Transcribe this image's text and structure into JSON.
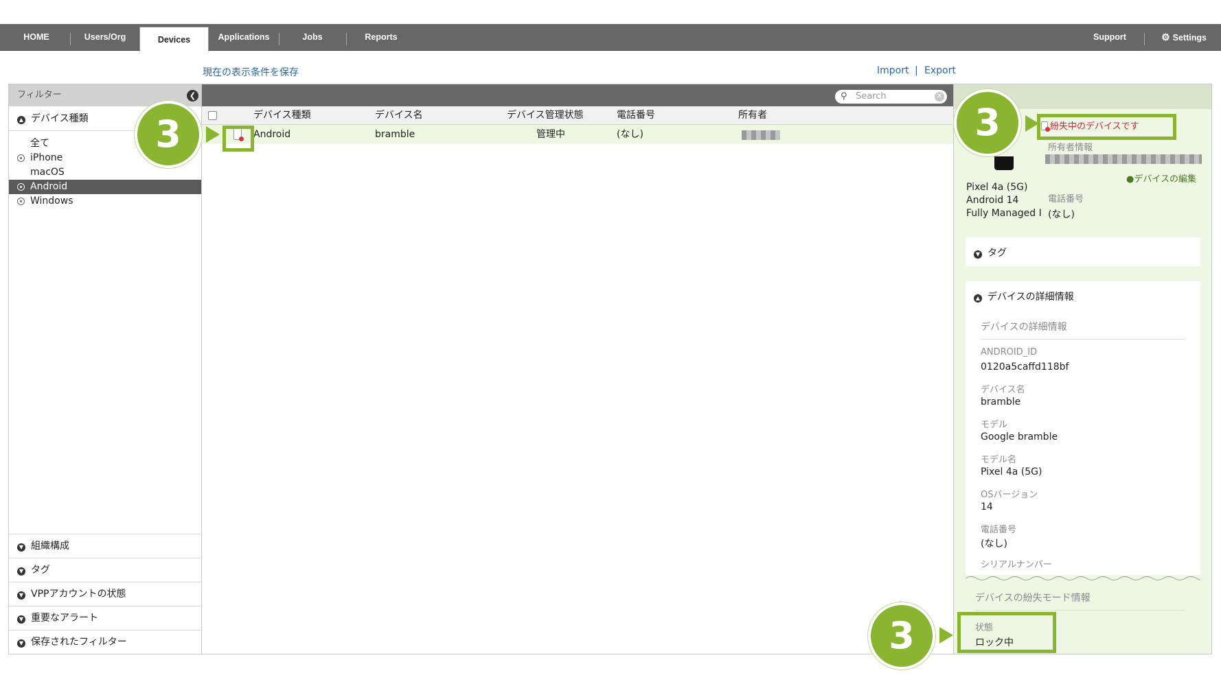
{
  "nav": {
    "items": [
      "HOME",
      "Users/Org",
      "Devices",
      "Applications",
      "Jobs",
      "Reports"
    ],
    "active": "Devices",
    "support": "Support",
    "settings": "Settings"
  },
  "toolbar_links": {
    "save_filter": "現在の表示条件を保存",
    "import": "Import",
    "separator": "|",
    "export": "Export"
  },
  "filter": {
    "title": "フィルター",
    "device_type_title": "デバイス種類",
    "device_types": [
      "全て",
      "iPhone",
      "macOS",
      "Android",
      "Windows"
    ],
    "selected_device_type": "Android",
    "bottom_sections": [
      "組織構成",
      "タグ",
      "VPPアカウントの状態",
      "重要なアラート",
      "保存されたフィルター"
    ]
  },
  "table": {
    "search_placeholder": "Search",
    "columns": [
      "デバイス種類",
      "デバイス名",
      "デバイス管理状態",
      "電話番号",
      "所有者"
    ],
    "rows": [
      {
        "device_type": "Android",
        "device_name": "bramble",
        "management_status": "管理中",
        "phone": "(なし)",
        "owner": ""
      }
    ]
  },
  "detail": {
    "lost_badge": "紛失中のデバイスです",
    "owner_info_label": "所有者情報",
    "edit_link": "デバイスの編集",
    "model_line": "Pixel 4a (5G)",
    "os_line": "Android 14",
    "mode_line": "Fully Managed I",
    "phone_label": "電話番号",
    "phone_value": "(なし)",
    "tag_section": "タグ",
    "details_section": "デバイスの詳細情報",
    "details_subtitle": "デバイスの詳細情報",
    "fields": [
      {
        "label": "ANDROID_ID",
        "value": "0120a5caffd118bf"
      },
      {
        "label": "デバイス名",
        "value": "bramble"
      },
      {
        "label": "モデル",
        "value": "Google bramble"
      },
      {
        "label": "モデル名",
        "value": "Pixel 4a (5G)"
      },
      {
        "label": "OSバージョン",
        "value": "14"
      },
      {
        "label": "電話番号",
        "value": "(なし)"
      },
      {
        "label": "シリアルナンバー",
        "value": ""
      }
    ],
    "lost_mode_title": "デバイスの紛失モード情報",
    "lost_state_label": "状態",
    "lost_state_value": "ロック中"
  },
  "callouts": [
    "3",
    "3",
    "3"
  ],
  "colors": {
    "nav_bg": "#676767",
    "accent_green": "#8ab531",
    "row_highlight": "#eef7e2",
    "detail_bg": "#eef6e4",
    "lost_red": "#d8233b",
    "link_blue": "#2b66a8"
  }
}
